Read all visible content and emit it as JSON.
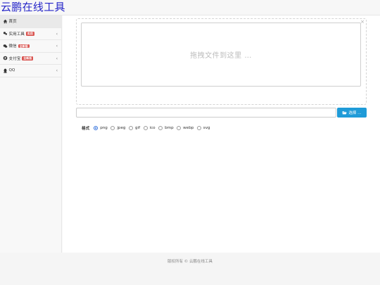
{
  "brand": {
    "title": "云鹏在线工具"
  },
  "sidebar": {
    "items": [
      {
        "label": "首页",
        "icon": "home-icon",
        "badge": null,
        "active": true
      },
      {
        "label": "实用工具",
        "icon": "wrench-icon",
        "badge": "实用",
        "active": false
      },
      {
        "label": "微信",
        "icon": "wechat-icon",
        "badge": "全新版",
        "active": false
      },
      {
        "label": "支付宝",
        "icon": "alipay-icon",
        "badge": "全新版",
        "active": false
      },
      {
        "label": "QQ",
        "icon": "qq-icon",
        "badge": null,
        "active": false
      }
    ]
  },
  "upload": {
    "drop_text": "拖拽文件到这里 …",
    "close_symbol": "×",
    "caption_value": "",
    "browse_label": "选择 …"
  },
  "format": {
    "label": "格式",
    "options": [
      "png",
      "jpeg",
      "gif",
      "ico",
      "bmp",
      "webp",
      "svg"
    ],
    "selected": "png"
  },
  "footer": {
    "text": "版权所有 © 云鹏在线工具"
  },
  "colors": {
    "brand": "#2525c8",
    "badge": "#d9534f",
    "button": "#1f9bd8",
    "radio_checked": "#2f6fdc"
  }
}
